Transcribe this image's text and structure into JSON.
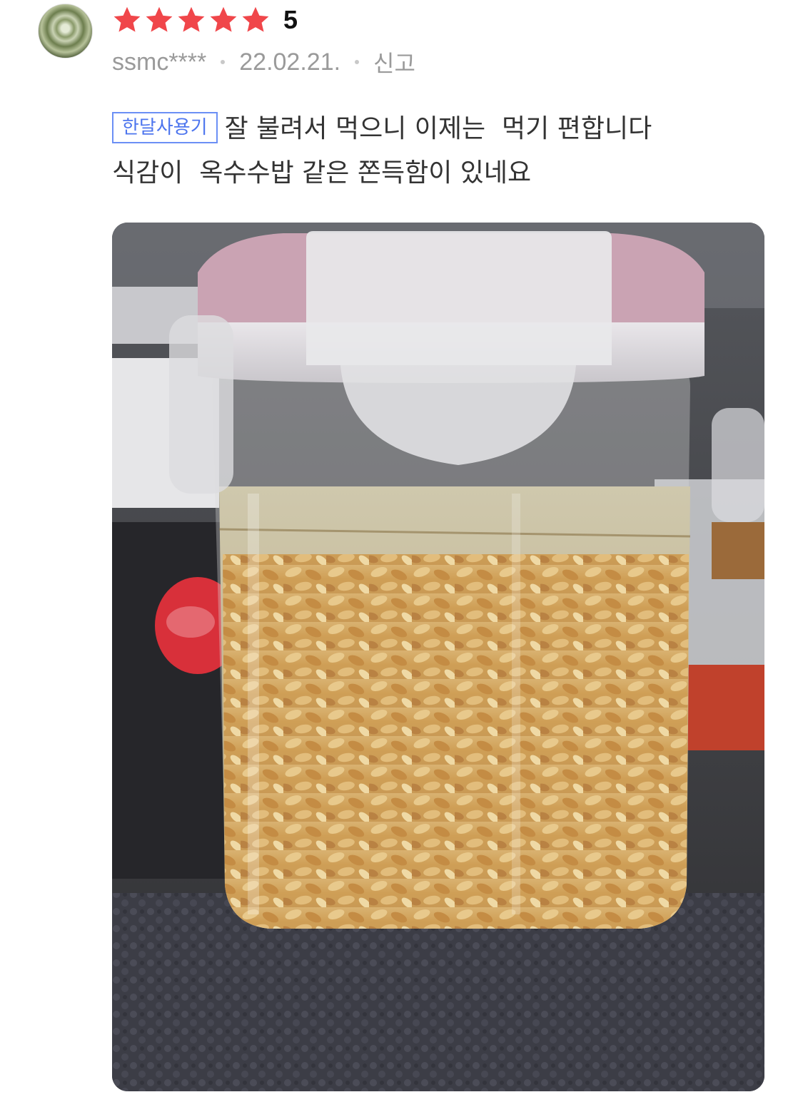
{
  "review": {
    "avatar_icon": "cabbage-photo-avatar",
    "star_icon": "star-icon",
    "star_color": "#f0464a",
    "rating": {
      "stars": 5,
      "score": "5"
    },
    "user": "ssmc****",
    "date": "22.02.21.",
    "report_label": "신고",
    "badge": "한달사용기",
    "text_line1": "잘 불려서 먹으니 이제는  먹기 편합니다",
    "text_line2": "식감이  옥수수밥 같은 쫀득함이 있네요",
    "badge_color": "#4d75ee"
  }
}
